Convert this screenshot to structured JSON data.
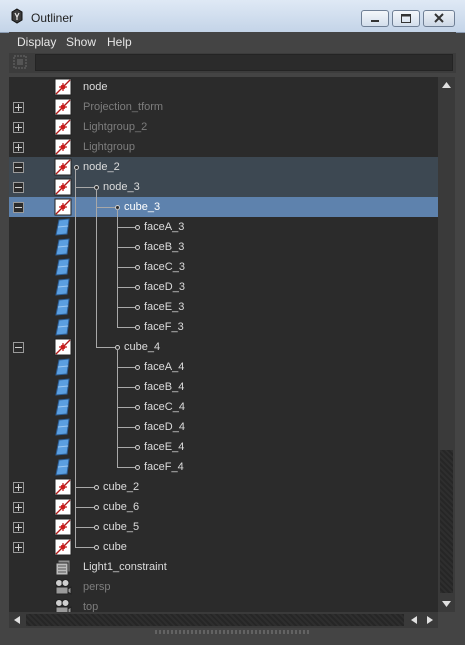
{
  "window": {
    "title": "Outliner",
    "controls": [
      "minimize-icon",
      "maximize-icon",
      "close-icon"
    ]
  },
  "menu": {
    "display": "Display",
    "show": "Show",
    "help": "Help"
  },
  "filter": {
    "value": ""
  },
  "tree": {
    "rows": [
      {
        "label": "node",
        "style": "normal",
        "icon": "transform-icon",
        "expander": "none"
      },
      {
        "label": "Projection_tform",
        "style": "dim",
        "icon": "transform-icon",
        "expander": "plus"
      },
      {
        "label": "Lightgroup_2",
        "style": "dim",
        "icon": "transform-icon",
        "expander": "plus"
      },
      {
        "label": "Lightgroup",
        "style": "dim",
        "icon": "transform-icon",
        "expander": "plus"
      },
      {
        "label": "node_2",
        "style": "normal",
        "icon": "transform-icon",
        "expander": "minus"
      },
      {
        "label": "node_3",
        "style": "normal",
        "icon": "transform-icon",
        "expander": "minus"
      },
      {
        "label": "cube_3",
        "style": "bright",
        "icon": "transform-icon",
        "expander": "minus"
      },
      {
        "label": "faceA_3",
        "style": "normal",
        "icon": "mesh-icon",
        "expander": "none"
      },
      {
        "label": "faceB_3",
        "style": "normal",
        "icon": "mesh-icon",
        "expander": "none"
      },
      {
        "label": "faceC_3",
        "style": "normal",
        "icon": "mesh-icon",
        "expander": "none"
      },
      {
        "label": "faceD_3",
        "style": "normal",
        "icon": "mesh-icon",
        "expander": "none"
      },
      {
        "label": "faceE_3",
        "style": "normal",
        "icon": "mesh-icon",
        "expander": "none"
      },
      {
        "label": "faceF_3",
        "style": "normal",
        "icon": "mesh-icon",
        "expander": "none"
      },
      {
        "label": "cube_4",
        "style": "normal",
        "icon": "transform-icon",
        "expander": "minus"
      },
      {
        "label": "faceA_4",
        "style": "normal",
        "icon": "mesh-icon",
        "expander": "none"
      },
      {
        "label": "faceB_4",
        "style": "normal",
        "icon": "mesh-icon",
        "expander": "none"
      },
      {
        "label": "faceC_4",
        "style": "normal",
        "icon": "mesh-icon",
        "expander": "none"
      },
      {
        "label": "faceD_4",
        "style": "normal",
        "icon": "mesh-icon",
        "expander": "none"
      },
      {
        "label": "faceE_4",
        "style": "normal",
        "icon": "mesh-icon",
        "expander": "none"
      },
      {
        "label": "faceF_4",
        "style": "normal",
        "icon": "mesh-icon",
        "expander": "none"
      },
      {
        "label": "cube_2",
        "style": "normal",
        "icon": "transform-icon",
        "expander": "plus"
      },
      {
        "label": "cube_6",
        "style": "normal",
        "icon": "transform-icon",
        "expander": "plus"
      },
      {
        "label": "cube_5",
        "style": "normal",
        "icon": "transform-icon",
        "expander": "plus"
      },
      {
        "label": "cube",
        "style": "normal",
        "icon": "transform-icon",
        "expander": "plus"
      },
      {
        "label": "Light1_constraint",
        "style": "normal",
        "icon": "constraint-icon",
        "expander": "none"
      },
      {
        "label": "persp",
        "style": "dim",
        "icon": "camera-icon",
        "expander": "none"
      },
      {
        "label": "top",
        "style": "dim",
        "icon": "camera-icon",
        "expander": "none"
      }
    ]
  },
  "colors": {
    "background": "#444444",
    "tree_background": "#2b2b2b",
    "selected": "#5e82ad",
    "selected_parent": "#3d4852"
  }
}
